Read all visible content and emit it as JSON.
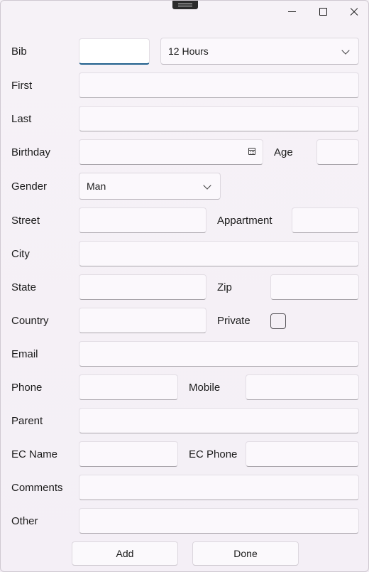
{
  "window": {
    "controls": {
      "minimize": "minimize-icon",
      "maximize": "maximize-icon",
      "close": "close-icon"
    }
  },
  "form": {
    "bib": {
      "label": "Bib",
      "value": ""
    },
    "duration": {
      "selected": "12 Hours"
    },
    "first": {
      "label": "First",
      "value": ""
    },
    "last": {
      "label": "Last",
      "value": ""
    },
    "birthday": {
      "label": "Birthday",
      "value": ""
    },
    "age": {
      "label": "Age",
      "value": ""
    },
    "gender": {
      "label": "Gender",
      "selected": "Man"
    },
    "street": {
      "label": "Street",
      "value": ""
    },
    "appartment": {
      "label": "Appartment",
      "value": ""
    },
    "city": {
      "label": "City",
      "value": ""
    },
    "state": {
      "label": "State",
      "value": ""
    },
    "zip": {
      "label": "Zip",
      "value": ""
    },
    "country": {
      "label": "Country",
      "value": ""
    },
    "private": {
      "label": "Private",
      "checked": false
    },
    "email": {
      "label": "Email",
      "value": ""
    },
    "phone": {
      "label": "Phone",
      "value": ""
    },
    "mobile": {
      "label": "Mobile",
      "value": ""
    },
    "parent": {
      "label": "Parent",
      "value": ""
    },
    "ec_name": {
      "label": "EC Name",
      "value": ""
    },
    "ec_phone": {
      "label": "EC Phone",
      "value": ""
    },
    "comments": {
      "label": "Comments",
      "value": ""
    },
    "other": {
      "label": "Other",
      "value": ""
    }
  },
  "actions": {
    "add_label": "Add",
    "done_label": "Done"
  }
}
